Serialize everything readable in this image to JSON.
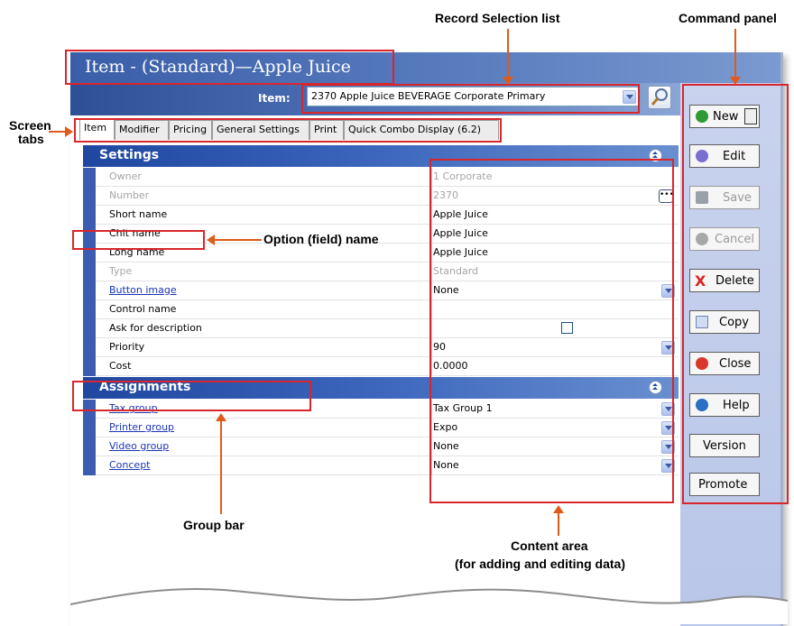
{
  "window": {
    "title": "Item - (Standard)—Apple Juice"
  },
  "record_selector": {
    "label": "Item:",
    "value": "2370 Apple Juice BEVERAGE Corporate Primary"
  },
  "tabs": [
    {
      "label": "Item",
      "active": true
    },
    {
      "label": "Modifier"
    },
    {
      "label": "Pricing"
    },
    {
      "label": "General Settings"
    },
    {
      "label": "Print"
    },
    {
      "label": "Quick Combo Display (6.2)"
    }
  ],
  "groups": {
    "settings": {
      "label": "Settings"
    },
    "assignments": {
      "label": "Assignments"
    }
  },
  "settings_rows": [
    {
      "label": "Owner",
      "value": "1  Corporate",
      "disabled": true
    },
    {
      "label": "Number",
      "value": "2370",
      "disabled": true
    },
    {
      "label": "Short name",
      "value": "Apple Juice"
    },
    {
      "label": "Chit name",
      "value": "Apple Juice"
    },
    {
      "label": "Long name",
      "value": "Apple Juice"
    },
    {
      "label": "Type",
      "value": "Standard",
      "disabled": true
    },
    {
      "label": "Button image",
      "value": "None",
      "link": true,
      "dropdown": true
    },
    {
      "label": "Control name",
      "value": ""
    },
    {
      "label": "Ask for description",
      "value": "",
      "checkbox": true,
      "checked": false
    },
    {
      "label": "Priority",
      "value": "90",
      "dropdown": true
    },
    {
      "label": "Cost",
      "value": "0.0000"
    }
  ],
  "assignment_rows": [
    {
      "label": "Tax group",
      "value": "Tax Group 1"
    },
    {
      "label": "Printer group",
      "value": "Expo"
    },
    {
      "label": "Video group",
      "value": "None"
    },
    {
      "label": "Concept",
      "value": "None"
    }
  ],
  "commands": [
    {
      "label": "New",
      "icon": "new-icon",
      "enabled": true
    },
    {
      "label": "Edit",
      "icon": "edit-icon",
      "enabled": true
    },
    {
      "label": "Save",
      "icon": "save-icon",
      "enabled": false
    },
    {
      "label": "Cancel",
      "icon": "cancel-icon",
      "enabled": false
    },
    {
      "label": "Delete",
      "icon": "delete-icon",
      "enabled": true
    },
    {
      "label": "Copy",
      "icon": "copy-icon",
      "enabled": true
    },
    {
      "label": "Close",
      "icon": "close-icon",
      "enabled": true
    },
    {
      "label": "Help",
      "icon": "help-icon",
      "enabled": true
    },
    {
      "label": "Version",
      "enabled": true
    },
    {
      "label": "Promote",
      "enabled": true
    }
  ],
  "callouts": {
    "record_selection_list": "Record Selection list",
    "command_panel": "Command panel",
    "screen_tabs_line1": "Screen",
    "screen_tabs_line2": "tabs",
    "option_field_name": "Option (field) name",
    "group_bar": "Group bar",
    "content_area_line1": "Content area",
    "content_area_line2": "(for adding and editing data)"
  },
  "colors": {
    "callout_red": "#d9262c",
    "arrow_orange": "#e05a1a",
    "group_bar_blue": "#1f47a0",
    "link_blue": "#1b35b7"
  }
}
